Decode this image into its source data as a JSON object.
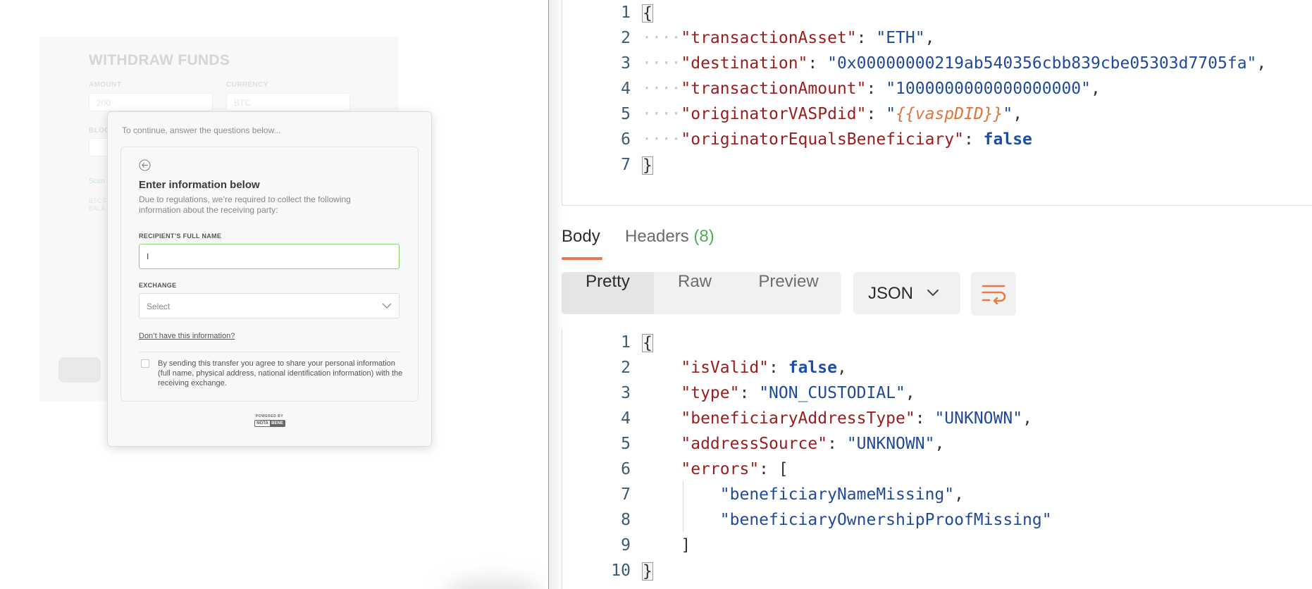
{
  "withdraw_form": {
    "title": "WITHDRAW FUNDS",
    "amount_label": "AMOUNT",
    "amount_value": "200",
    "currency_label": "CURRENCY",
    "currency_value": "BTC",
    "blockchain_label_partial": "BLOC",
    "green_partial": "Scan",
    "small_partial_1": "BTC F",
    "small_partial_2": "BALA"
  },
  "modal": {
    "hint": "To continue, answer the questions below...",
    "title": "Enter information below",
    "description": "Due to regulations, we’re required to collect the following information about the receiving party:",
    "recipient_label": "RECIPIENT’S FULL NAME",
    "recipient_value": "I",
    "exchange_label": "EXCHANGE",
    "exchange_placeholder": "Select",
    "dont_have_link": "Don’t have this information?",
    "agreement_text": "By sending this transfer you agree to share your personal information (full name, physical address, national identification information) with the receiving exchange.",
    "powered_by": "POWERED BY",
    "logo_left": "NOTA",
    "logo_right": "BENE"
  },
  "request_body": {
    "line_numbers": [
      "1",
      "2",
      "3",
      "4",
      "5",
      "6",
      "7"
    ],
    "open_brace": "{",
    "close_brace": "}",
    "k_transactionAsset": "\"transactionAsset\"",
    "v_transactionAsset": "\"ETH\"",
    "k_destination": "\"destination\"",
    "v_destination": "\"0x00000000219ab540356cbb839cbe05303d7705fa\"",
    "k_transactionAmount": "\"transactionAmount\"",
    "v_transactionAmount": "\"1000000000000000000\"",
    "k_originatorVASPdid": "\"originatorVASPdid\"",
    "v_originatorVASPdid_var": "{{vaspDID}}",
    "k_originatorEqualsBeneficiary": "\"originatorEqualsBeneficiary\"",
    "v_originatorEqualsBeneficiary": "false"
  },
  "response_tabs": {
    "body": "Body",
    "headers": "Headers",
    "headers_count": "(8)"
  },
  "view_modes": {
    "pretty": "Pretty",
    "raw": "Raw",
    "preview": "Preview",
    "format": "JSON"
  },
  "response_body": {
    "line_numbers": [
      "1",
      "2",
      "3",
      "4",
      "5",
      "6",
      "7",
      "8",
      "9",
      "10"
    ],
    "open_brace": "{",
    "close_brace": "}",
    "k_isValid": "\"isValid\"",
    "v_isValid": "false",
    "k_type": "\"type\"",
    "v_type": "\"NON_CUSTODIAL\"",
    "k_beneficiaryAddressType": "\"beneficiaryAddressType\"",
    "v_beneficiaryAddressType": "\"UNKNOWN\"",
    "k_addressSource": "\"addressSource\"",
    "v_addressSource": "\"UNKNOWN\"",
    "k_errors": "\"errors\"",
    "open_bracket": "[",
    "close_bracket": "]",
    "error_1": "\"beneficiaryNameMissing\"",
    "error_2": "\"beneficiaryOwnershipProofMissing\""
  },
  "colors": {
    "accent": "#e87b45",
    "headers_count": "#4caf50",
    "json_key": "#9b1c1c",
    "json_string": "#214a9a",
    "json_variable": "#e0753a",
    "input_focus": "#8bd16b"
  }
}
